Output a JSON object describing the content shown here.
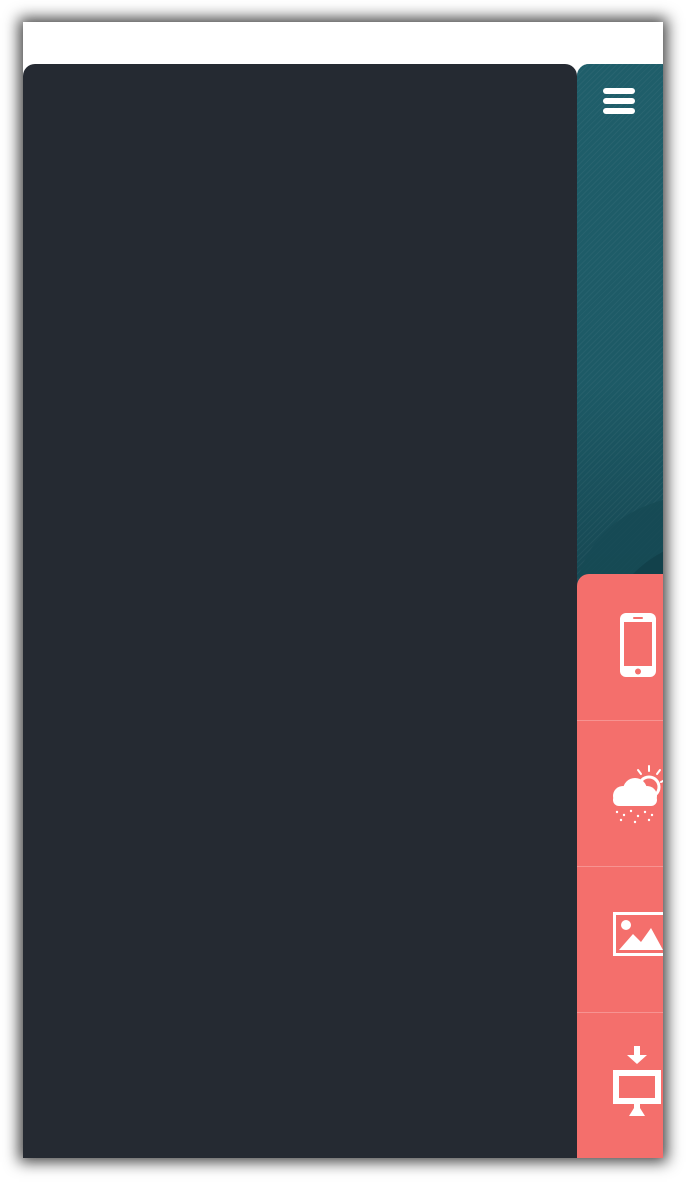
{
  "app": {
    "colors": {
      "drawer": "#252a32",
      "hero": "#1e5c68",
      "tiles": "#f46f6c",
      "icon": "#ffffff"
    }
  },
  "header": {
    "menu_icon": "hamburger-menu-icon"
  },
  "tiles": [
    {
      "icon": "smartphone-icon"
    },
    {
      "icon": "weather-icon"
    },
    {
      "icon": "image-icon"
    },
    {
      "icon": "download-to-desktop-icon"
    }
  ]
}
